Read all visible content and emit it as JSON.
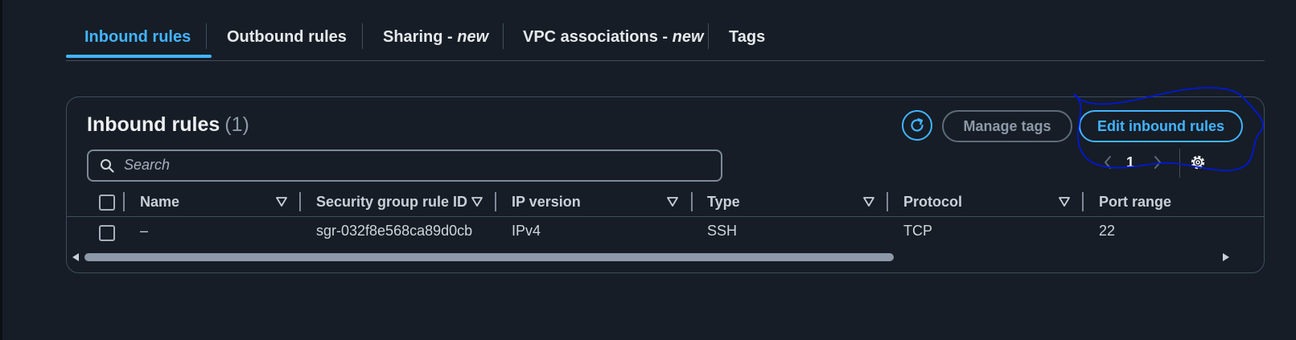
{
  "tabs": [
    {
      "label": "Inbound rules",
      "suffix": ""
    },
    {
      "label": "Outbound rules",
      "suffix": ""
    },
    {
      "label": "Sharing - ",
      "suffix": "new"
    },
    {
      "label": "VPC associations - ",
      "suffix": "new"
    },
    {
      "label": "Tags",
      "suffix": ""
    }
  ],
  "panel": {
    "title": "Inbound rules",
    "count": "(1)",
    "manage_tags_label": "Manage tags",
    "edit_label": "Edit inbound rules",
    "search_placeholder": "Search",
    "page_number": "1"
  },
  "table": {
    "columns": [
      "Name",
      "Security group rule ID",
      "IP version",
      "Type",
      "Protocol",
      "Port range"
    ],
    "rows": [
      [
        "–",
        "sgr-032f8e568ca89d0cb",
        "IPv4",
        "SSH",
        "TCP",
        "22"
      ]
    ]
  },
  "icons": {
    "refresh": "refresh-icon",
    "search": "search-icon",
    "settings": "gear-icon",
    "sort": "caret-down-icon"
  },
  "colors": {
    "accent": "#42b4ff",
    "background": "#161d26",
    "annotation": "#0018d8"
  }
}
